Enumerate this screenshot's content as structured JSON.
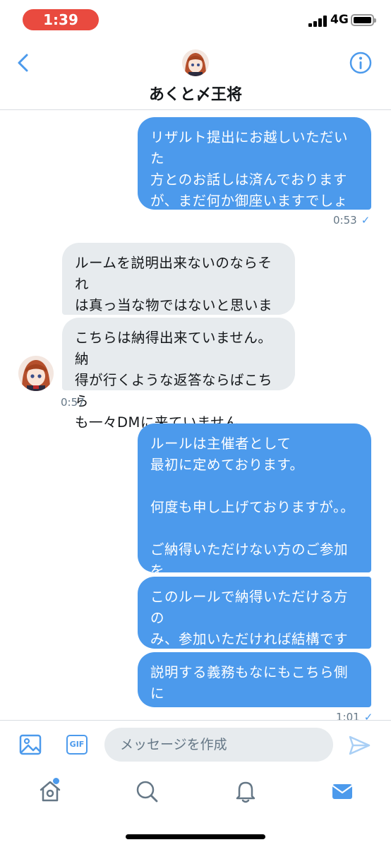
{
  "status_bar": {
    "time": "1:39",
    "network": "4G"
  },
  "header": {
    "title": "あくと〆王将"
  },
  "messages": [
    {
      "direction": "out",
      "text": "リザルト提出にお越しいただいた\n方とのお話しは済んでおります\nが、まだ何か御座いますでしょう\nか？"
    },
    {
      "direction": "in",
      "text": "ルームを説明出来ないのならそれ\nは真っ当な物ではないと思います\nが…"
    },
    {
      "direction": "in",
      "text": "こちらは納得出来ていません。納\n得が行くような返答ならばこちら\nも一々DMに来ていません。"
    },
    {
      "direction": "out",
      "text": "ルールは主催者として\n最初に定めております。\n\n何度も申し上げておりますが。。\n\nご納得いただけない方のご参加を\n強制はしておりません。"
    },
    {
      "direction": "out",
      "text": "このルールで納得いただける方の\nみ、参加いただければ結構ですの\nで。"
    },
    {
      "direction": "out",
      "text": "説明する義務もなにもこちら側に\nは御座いません。"
    }
  ],
  "timestamps": {
    "t1": "0:53",
    "t2": "0:57",
    "t3": "1:01"
  },
  "composer": {
    "placeholder": "メッセージを作成",
    "gif_label": "GIF"
  },
  "colors": {
    "accent": "#4c9aec",
    "incoming_bubble": "#e7ebee",
    "status_pill": "#e94a3f"
  }
}
